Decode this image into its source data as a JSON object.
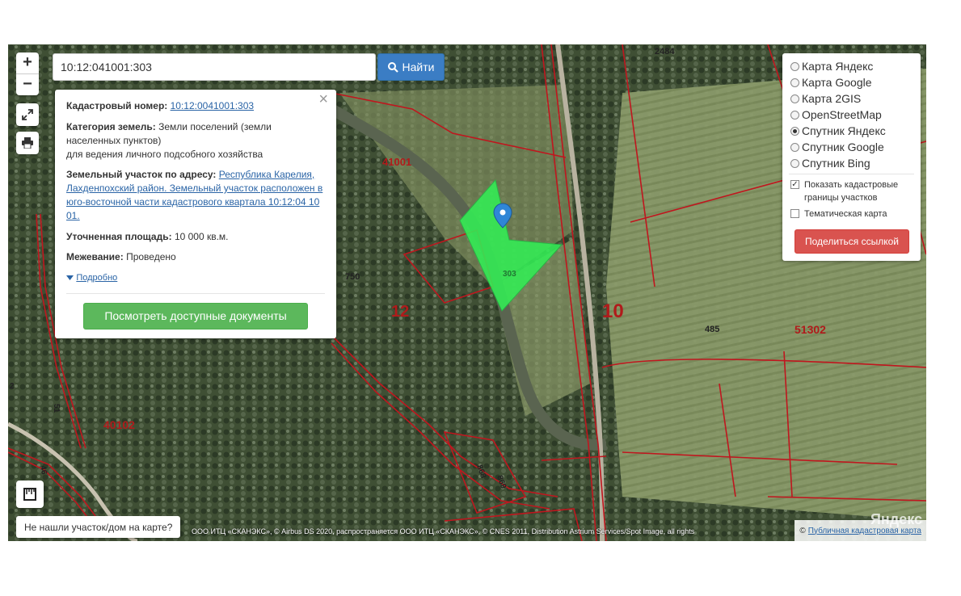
{
  "search": {
    "value": "10:12:041001:303",
    "button_label": "Найти"
  },
  "zoom": {
    "in_label": "+",
    "out_label": "−"
  },
  "info": {
    "cadastral_label": "Кадастровый номер:",
    "cadastral_value": "10:12:0041001:303",
    "category_label": "Категория земель:",
    "category_value": "Земли поселений (земли населенных пунктов)",
    "category_use": "для ведения личного подсобного хозяйства",
    "address_label": "Земельный участок по адресу:",
    "address_value": "Республика Карелия, Лахденпохский район. Земельный участок расположен в юго-восточной части кадастрового квартала 10:12:04 10 01.",
    "area_label": "Уточненная площадь:",
    "area_value": "10 000 кв.м.",
    "survey_label": "Межевание:",
    "survey_value": "Проведено",
    "more_label": "Подробно",
    "docs_button": "Посмотреть доступные документы"
  },
  "layers": {
    "options": [
      "Карта Яндекс",
      "Карта Google",
      "Карта 2GIS",
      "OpenStreetMap",
      "Спутник Яндекс",
      "Спутник Google",
      "Спутник Bing"
    ],
    "selected": "Спутник Яндекс",
    "checkboxes": [
      {
        "label": "Показать кадастровые границы участков",
        "checked": true
      },
      {
        "label": "Тематическая карта",
        "checked": false
      }
    ],
    "share_button": "Поделиться ссылкой"
  },
  "notfound_button": "Не нашли участок/дом на карте?",
  "copyright": "ООО ИТЦ «СКАНЭКС», © Airbus DS 2020, распространяется ООО ИТЦ «СКАНЭКС», © CNES 2011, Distribution Astrium Services/Spot Image, all rights",
  "attribution": {
    "prefix": "©",
    "link": "Публичная кадастровая карта"
  },
  "yandex_logo": "Яндекс",
  "map_labels": [
    "2484",
    "41001",
    "750",
    "12",
    "303",
    "10",
    "485",
    "51302",
    "40102",
    "868",
    "869",
    "51",
    "46",
    "2"
  ],
  "colors": {
    "parcel_fill": "#33ee55",
    "boundary": "#c0161e",
    "marker": "#2f86d6"
  }
}
